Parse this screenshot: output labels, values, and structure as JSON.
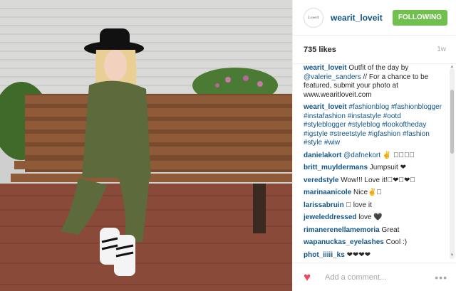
{
  "header": {
    "avatar_text": "Loveit",
    "username": "wearit_loveit",
    "follow_label": "FOLLOWING"
  },
  "stats": {
    "likes": "735 likes",
    "age": "1w"
  },
  "comments": [
    {
      "user": "wearit_loveit",
      "parts": [
        {
          "t": " Outfit of the day by "
        },
        {
          "t": "@valerie_sanders",
          "tag": true
        },
        {
          "t": " // For a chance to be featured, submit your photo at www.wearitloveit.com"
        }
      ]
    },
    {
      "user": "wearit_loveit",
      "parts": [
        {
          "t": " "
        },
        {
          "t": "#fashionblog #fashionblogger #instafashion #instastyle #ootd #styleblogger #styleblog #lookoftheday #igstyle #streetstyle #igfashion #fashion #style #wiw",
          "tag": true
        }
      ]
    },
    {
      "user": "danielakort",
      "parts": [
        {
          "t": " "
        },
        {
          "t": "@dafnekort",
          "tag": true
        },
        {
          "t": " ✌ 􏿿􏿿􏿿􏿿"
        }
      ]
    },
    {
      "user": "britt_muyldermans",
      "parts": [
        {
          "t": " Jumpsuit ❤"
        }
      ]
    },
    {
      "user": "veredstyle",
      "parts": [
        {
          "t": " Wow!!! Love it!􏿿❤􏿿❤􏿿"
        }
      ]
    },
    {
      "user": "marinaanicole",
      "parts": [
        {
          "t": " Nice✌􏿿"
        }
      ]
    },
    {
      "user": "larissabruin",
      "parts": [
        {
          "t": " 􏿿 love it"
        }
      ]
    },
    {
      "user": "jeweleddressed",
      "parts": [
        {
          "t": " love 🖤"
        }
      ]
    },
    {
      "user": "rimanerenellamemoria",
      "parts": [
        {
          "t": " Great"
        }
      ]
    },
    {
      "user": "wapanuckas_eyelashes",
      "parts": [
        {
          "t": " Cool :)"
        }
      ]
    },
    {
      "user": "phot_iiiii_ks",
      "parts": [
        {
          "t": " ❤❤❤❤"
        }
      ]
    }
  ],
  "footer": {
    "placeholder": "Add a comment...",
    "more": "•••"
  },
  "icons": {
    "heart": "heart-icon",
    "more": "more-options-icon"
  },
  "colors": {
    "follow_green": "#70c050",
    "link_blue": "#125688",
    "heart_red": "#ed4956"
  }
}
